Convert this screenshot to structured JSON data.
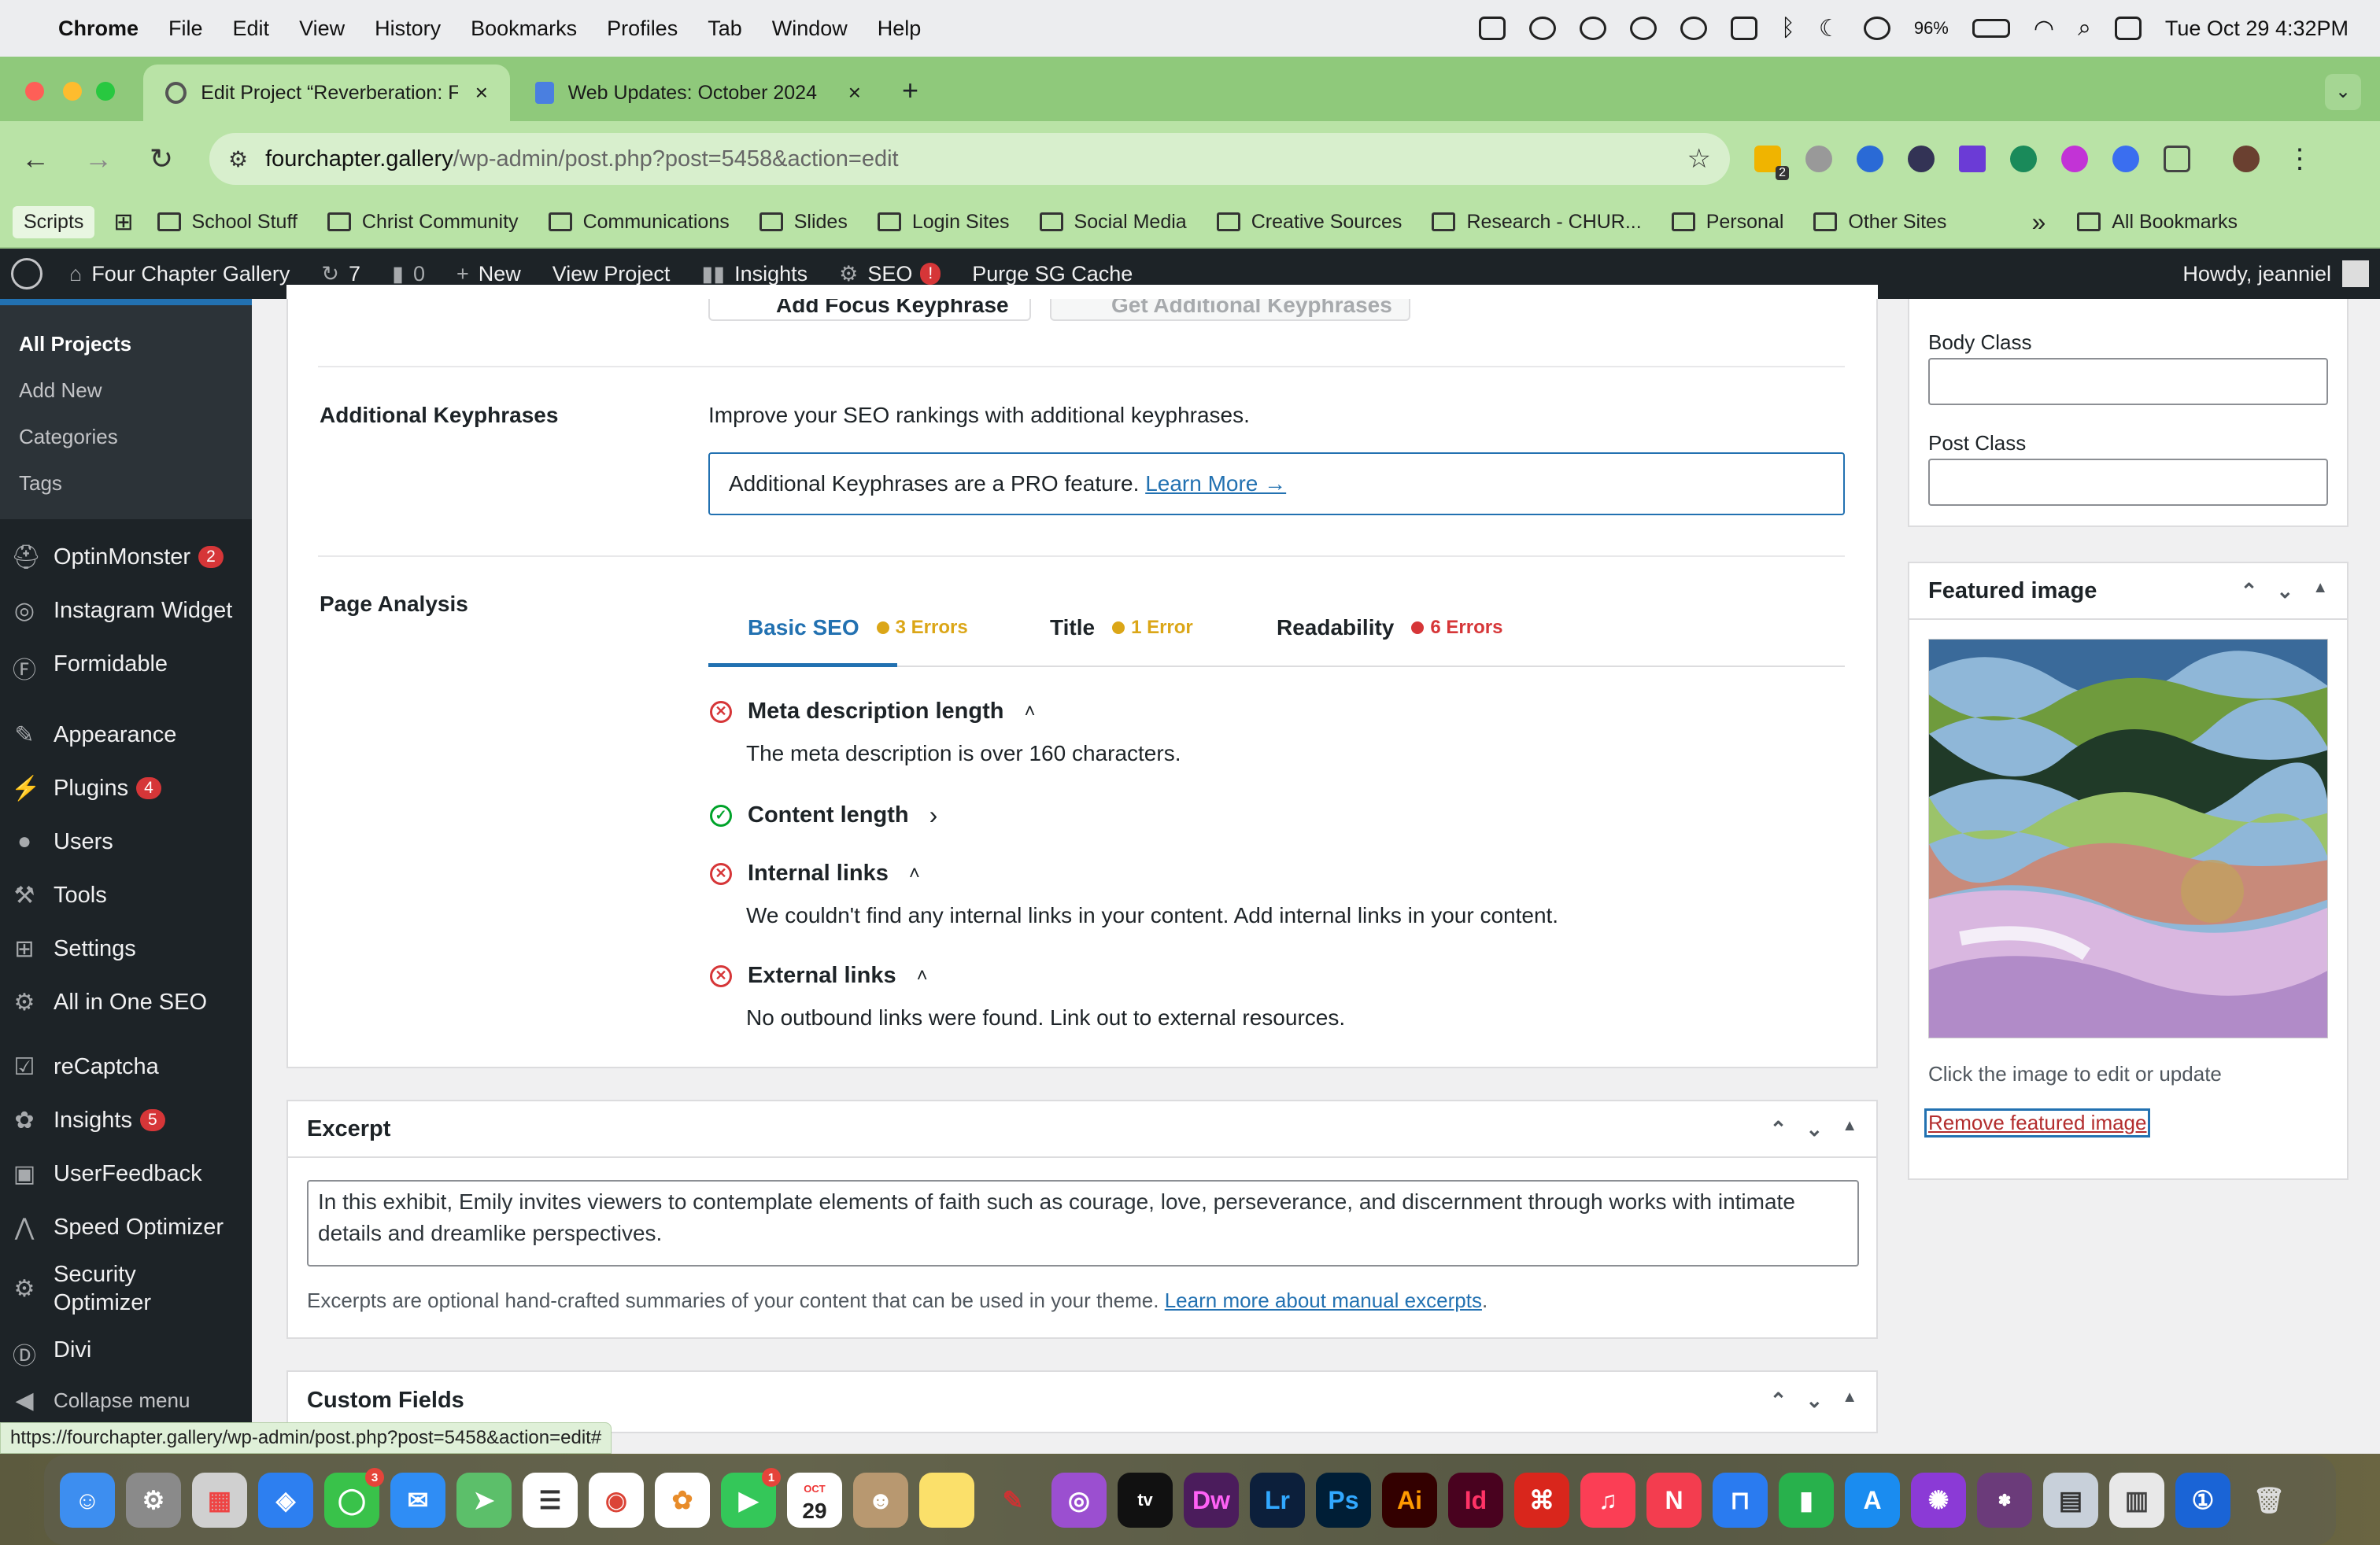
{
  "menubar": {
    "items": [
      "Chrome",
      "File",
      "Edit",
      "View",
      "History",
      "Bookmarks",
      "Profiles",
      "Tab",
      "Window",
      "Help"
    ],
    "battery": "96%",
    "datetime": "Tue Oct 29  4:32PM"
  },
  "browser": {
    "tabs": [
      {
        "title": "Edit Project “Reverberation: F",
        "active": true
      },
      {
        "title": "Web Updates: October 2024",
        "active": false
      }
    ],
    "new_tab": "+",
    "url_host": "fourchapter.gallery",
    "url_path": "/wp-admin/post.php?post=5458&action=edit",
    "extension_badge": "2",
    "bookmarks": [
      "School Stuff",
      "Christ Community",
      "Communications",
      "Slides",
      "Login Sites",
      "Social Media",
      "Creative Sources",
      "Research - CHUR...",
      "Personal",
      "Other Sites"
    ],
    "scripts_label": "Scripts",
    "overflow": "»",
    "all_bookmarks": "All Bookmarks",
    "status_url": "https://fourchapter.gallery/wp-admin/post.php?post=5458&action=edit#"
  },
  "adminbar": {
    "site": "Four Chapter Gallery",
    "updates": "7",
    "comments": "0",
    "new": "New",
    "view_project": "View Project",
    "insights": "Insights",
    "seo": "SEO",
    "seo_badge": "!",
    "purge": "Purge SG Cache",
    "howdy": "Howdy, jeanniel"
  },
  "sidebar": {
    "submenu": [
      "All Projects",
      "Add New",
      "Categories",
      "Tags"
    ],
    "items": [
      {
        "label": "OptinMonster",
        "badge": "2",
        "icon": "optinmonster-icon"
      },
      {
        "label": "Instagram Widget",
        "icon": "instagram-icon"
      },
      {
        "label": "Formidable",
        "icon": "formidable-icon"
      },
      {
        "label": "Appearance",
        "icon": "appearance-icon"
      },
      {
        "label": "Plugins",
        "badge": "4",
        "icon": "plugins-icon"
      },
      {
        "label": "Users",
        "icon": "users-icon"
      },
      {
        "label": "Tools",
        "icon": "tools-icon"
      },
      {
        "label": "Settings",
        "icon": "settings-icon"
      },
      {
        "label": "All in One SEO",
        "icon": "aioseo-icon"
      },
      {
        "label": "reCaptcha",
        "icon": "recaptcha-icon"
      },
      {
        "label": "Insights",
        "badge": "5",
        "icon": "insights-icon"
      },
      {
        "label": "UserFeedback",
        "icon": "userfeedback-icon"
      },
      {
        "label": "Speed Optimizer",
        "icon": "speed-icon"
      },
      {
        "label": "Security Optimizer",
        "icon": "security-icon"
      },
      {
        "label": "Divi",
        "icon": "divi-icon"
      },
      {
        "label": "Collapse menu",
        "icon": "collapse-icon"
      }
    ]
  },
  "seo": {
    "add_focus": "Add Focus Keyphrase",
    "get_additional": "Get Additional Keyphrases",
    "additional_label": "Additional Keyphrases",
    "additional_desc": "Improve your SEO rankings with additional keyphrases.",
    "promo_text": "Additional Keyphrases are a PRO feature.",
    "promo_link": "Learn More →",
    "analysis_label": "Page Analysis",
    "tabs": [
      {
        "label": "Basic SEO",
        "count": "3 Errors",
        "color": "#dba617"
      },
      {
        "label": "Title",
        "count": "1 Error",
        "color": "#dba617"
      },
      {
        "label": "Readability",
        "count": "6 Errors",
        "color": "#d63638"
      }
    ],
    "checks": [
      {
        "title": "Meta description length",
        "status": "error",
        "desc": "The meta description is over 160 characters.",
        "chevron": "˄"
      },
      {
        "title": "Content length",
        "status": "ok",
        "desc": "",
        "chevron": "›"
      },
      {
        "title": "Internal links",
        "status": "error",
        "desc": "We couldn't find any internal links in your content. Add internal links in your content.",
        "chevron": "˄"
      },
      {
        "title": "External links",
        "status": "error",
        "desc": "No outbound links were found. Link out to external resources.",
        "chevron": "˄"
      }
    ]
  },
  "excerpt": {
    "title": "Excerpt",
    "text": "In this exhibit, Emily invites viewers to contemplate elements of faith such as courage, love, perseverance, and discernment through works with intimate details and dreamlike perspectives.",
    "note": "Excerpts are optional hand-crafted summaries of your content that can be used in your theme.",
    "note_link": "Learn more about manual excerpts",
    "note_end": "."
  },
  "custom_fields": {
    "title": "Custom Fields"
  },
  "right": {
    "body_class": "Body Class",
    "post_class": "Post Class",
    "featured_title": "Featured image",
    "featured_hint": "Click the image to edit or update",
    "remove_link": "Remove featured image"
  },
  "dock": [
    "Finder",
    "Settings",
    "Launchpad",
    "Safari",
    "Messages",
    "Mail",
    "Maps",
    "Reminders",
    "Chrome",
    "Photos",
    "FaceTime",
    "Calendar",
    "Contacts",
    "Notes",
    "Pencil",
    "Podcasts",
    "TV",
    "Dw",
    "Lr",
    "Ps",
    "Ai",
    "Id",
    "Acrobat",
    "Music",
    "News",
    "Keynote",
    "Numbers",
    "App Store",
    "Feedback",
    "Business",
    "Preview",
    "Archive",
    "1Password",
    "Trash"
  ],
  "dock_calendar_month": "OCT",
  "dock_calendar_day": "29",
  "colors": {
    "wp_dark": "#1d2327",
    "wp_blue": "#2271b1",
    "error": "#d63638",
    "ok": "#00a32a",
    "warn": "#dba617",
    "chrome_green": "#b9e3a6"
  }
}
